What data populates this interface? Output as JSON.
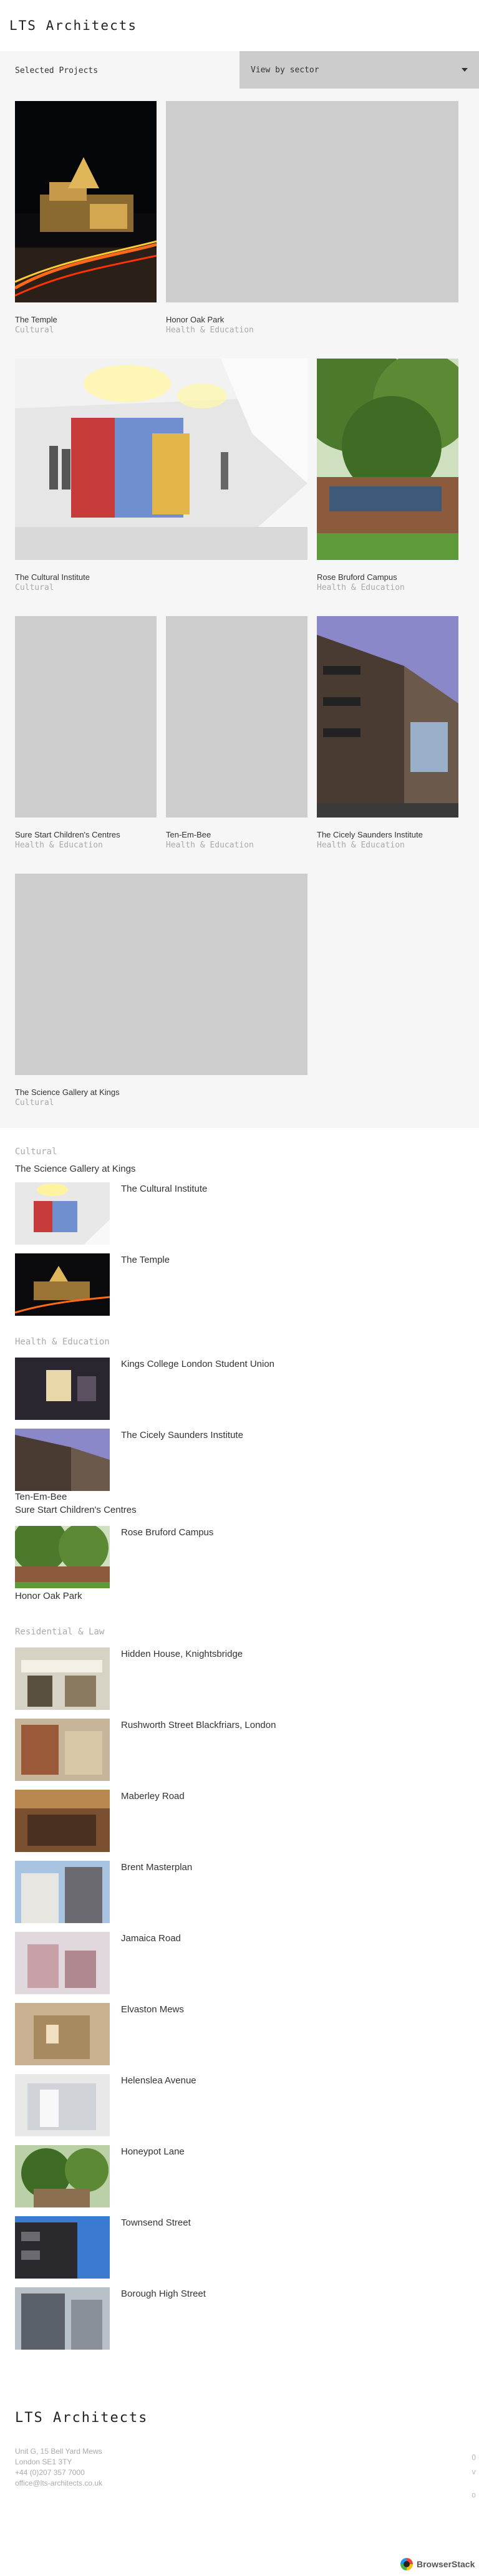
{
  "site": {
    "logo": "LTS Architects"
  },
  "filter": {
    "label": "Selected Projects",
    "select_value": "View by sector"
  },
  "tiles": [
    {
      "title": "The Temple",
      "sector": "Cultural"
    },
    {
      "title": "Honor Oak Park",
      "sector": "Health & Education"
    },
    {
      "title": "The Cultural Institute",
      "sector": "Cultural"
    },
    {
      "title": "Rose Bruford Campus",
      "sector": "Health & Education"
    },
    {
      "title": "Sure Start Children's Centres",
      "sector": "Health & Education"
    },
    {
      "title": "Ten-Em-Bee",
      "sector": "Health & Education"
    },
    {
      "title": "The Cicely Saunders Institute",
      "sector": "Health & Education"
    },
    {
      "title": "The Science Gallery at Kings",
      "sector": "Cultural"
    }
  ],
  "sectors": {
    "cultural": {
      "heading": "Cultural",
      "plain": [
        "The Science Gallery at Kings"
      ],
      "items": [
        "The Cultural Institute",
        "The Temple"
      ]
    },
    "health": {
      "heading": "Health & Education",
      "items_a": [
        "Kings College London Student Union",
        "The Cicely Saunders Institute"
      ],
      "plain_a": [
        "Ten-Em-Bee",
        "Sure Start Children's Centres"
      ],
      "items_b": [
        "Rose Bruford Campus"
      ],
      "plain_b": [
        "Honor Oak Park"
      ]
    },
    "residential": {
      "heading": "Residential & Law",
      "items": [
        "Hidden House, Knightsbridge",
        "Rushworth Street Blackfriars, London",
        "Maberley Road",
        "Brent Masterplan",
        "Jamaica Road",
        "Elvaston Mews",
        "Helenslea Avenue",
        "Honeypot Lane",
        "Townsend Street",
        "Borough High Street"
      ]
    }
  },
  "footer": {
    "logo": "LTS Architects",
    "address_1": "Unit G, 15 Bell Yard Mews",
    "address_2": "London SE1 3TY",
    "phone": "+44 (0)207 357 7000",
    "email": "office@lts-architects.co.uk",
    "side_1": "O",
    "side_2": "v",
    "side_3": "o",
    "badge": "BrowserStack"
  },
  "colors": {
    "grid_bg": "#f6f6f6",
    "placeholder": "#cdcdcd",
    "select_bg": "#cccccc",
    "muted_text": "#aaaaaa"
  }
}
